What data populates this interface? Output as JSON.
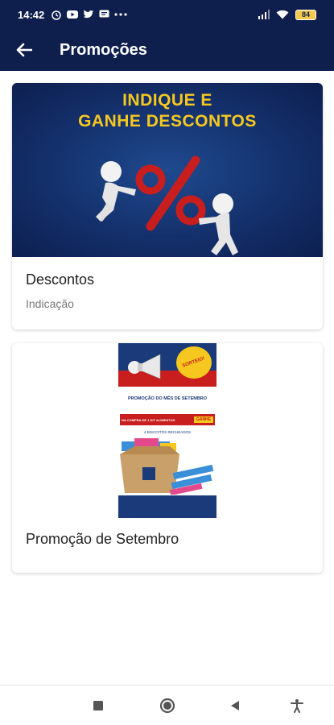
{
  "statusbar": {
    "time": "14:42",
    "battery": "84"
  },
  "appbar": {
    "title": "Promoções"
  },
  "promotions": [
    {
      "banner_line1": "INDIQUE E",
      "banner_line2": "GANHE DESCONTOS",
      "title": "Descontos",
      "subtitle": "Indicação"
    },
    {
      "title": "Promoção de Setembro",
      "flyer": {
        "badge": "SORTEIO!",
        "heading": "PROMOÇÃO DO MÊS DE SETEMBRO",
        "offer": "NA COMPRA DE 1 KIT ALIMENTOS",
        "win": "GANHE",
        "prize": "4 BISCOITOS RECHEADOS"
      }
    }
  ],
  "colors": {
    "primary": "#0f1f4d",
    "banner_text": "#f6c81f"
  }
}
